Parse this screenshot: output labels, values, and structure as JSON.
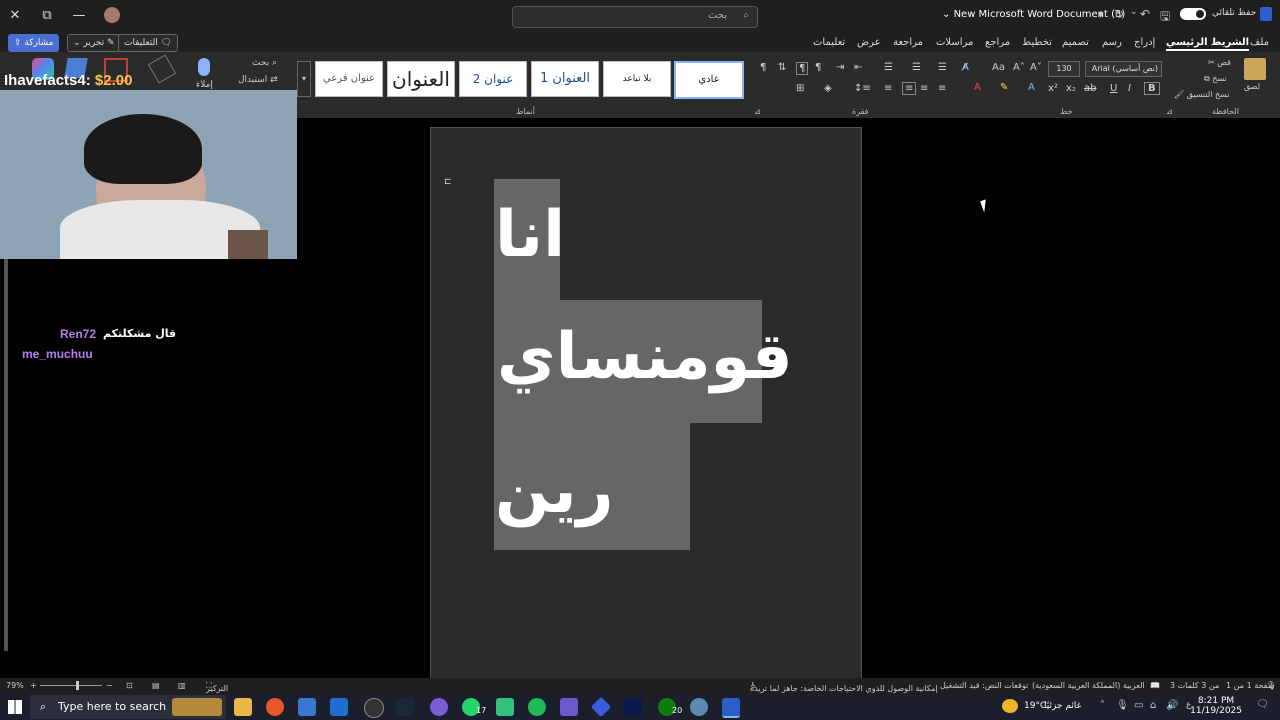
{
  "titlebar": {
    "doc_title": "New Microsoft Word Document (3)",
    "search_placeholder": "بحث",
    "autosave_label": "حفظ تلقائي"
  },
  "tabs": [
    "ملف",
    "الشريط الرئيسي",
    "إدراج",
    "رسم",
    "تصميم",
    "تخطيط",
    "مراجع",
    "مراسلات",
    "مراجعة",
    "عرض",
    "تعليمات"
  ],
  "tab_buttons": {
    "comments": "التعليقات",
    "edit": "تحرير",
    "share": "مشاركة"
  },
  "ribbon": {
    "clipboard": {
      "label": "الحافظة",
      "paste": "لصق",
      "cut": "قص",
      "copy": "نسخ",
      "format_painter": "نسخ التنسيق"
    },
    "font": {
      "label": "خط",
      "font_name": "Arial (نص أساسي)",
      "font_size": "130"
    },
    "paragraph": {
      "label": "فقرة"
    },
    "styles": {
      "label": "أنماط",
      "items": [
        "عادي",
        "بلا تباعد",
        "العنوان 1",
        "عنوان 2",
        "العنوان",
        "عنوان فرعي"
      ]
    },
    "editing": {
      "search": "بحث",
      "replace": "استبدال"
    },
    "voice": {
      "dictate": "إملاء"
    }
  },
  "document": {
    "line1": "انا",
    "line2": "قومنساي",
    "line3": "رين"
  },
  "stream_overlay": {
    "donor": "Ihavefacts4:",
    "amount": "$2.00"
  },
  "chat": [
    {
      "user": "Ren72",
      "message": "قال مشكلتكم",
      "color": "#b77cf0"
    },
    {
      "user": "me_muchuu",
      "message": "",
      "color": "#b77cf0"
    }
  ],
  "statusbar": {
    "page": "صفحة 1 من 1",
    "words": "3 من 3 كلمات",
    "language": "العربية (المملكة العربية السعودية)",
    "predictions": "توقعات النص: قيد التشغيل",
    "accessibility": "إمكانية الوصول للذوي الاحتياجات الخاصة: جاهز لما تريده",
    "focus": "التركيز",
    "zoom": "79%"
  },
  "taskbar": {
    "search_placeholder": "Type here to search",
    "weather": "19°C",
    "weather_desc": "غائم جزئيًا",
    "time": "8:21 PM",
    "date": "11/19/2025",
    "lang": "ع",
    "badge_whatsapp": "17",
    "badge_xbox": "20"
  },
  "colors": {
    "accent": "#4a6fd0",
    "highlight": "#666666",
    "page_bg": "#2b2b2b"
  }
}
